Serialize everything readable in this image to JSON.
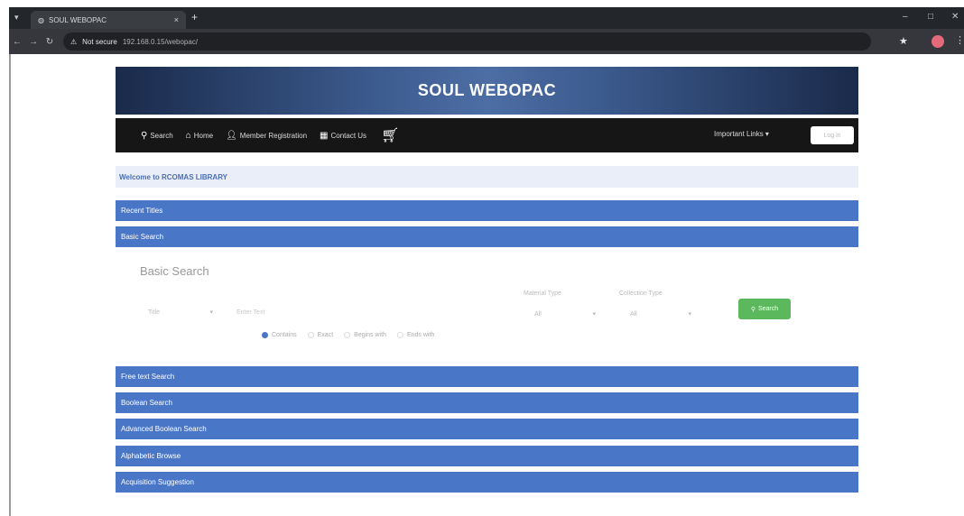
{
  "browser": {
    "tab_title": "SOUL WEBOPAC",
    "tab_close": "×",
    "new_tab": "+",
    "security_label": "Not secure",
    "url": "192.168.0.15/webopac/",
    "icons": [
      "back-icon",
      "forward-icon",
      "reload-icon",
      "warning-icon",
      "star-icon",
      "profile-icon",
      "menu-icon"
    ]
  },
  "banner": {
    "title": "SOUL WEBOPAC"
  },
  "navbar": {
    "items": [
      {
        "label": "Search",
        "icon": "search-icon"
      },
      {
        "label": "Home",
        "icon": "home-icon"
      },
      {
        "label": "Member Registration",
        "icon": "user-icon"
      },
      {
        "label": "Contact Us",
        "icon": "contact-icon"
      }
    ],
    "cart_icon": "cart-icon",
    "important_links": "Important Links ▾",
    "login": "Log in"
  },
  "welcome": "Welcome to RCOMAS LIBRARY",
  "panels_top": [
    "Recent Titles",
    "Basic Search"
  ],
  "basic_search": {
    "heading": "Basic Search",
    "field_select": "Title",
    "text_placeholder": "Enter Text",
    "material_type_label": "Material Type",
    "material_type_value": "All",
    "collection_type_label": "Collection Type",
    "collection_type_value": "All",
    "search_button": "Search",
    "match_options": [
      "Contains",
      "Exact",
      "Begins with",
      "Ends with"
    ],
    "selected_match": "Contains"
  },
  "panels_bottom": [
    "Free text Search",
    "Boolean Search",
    "Advanced Boolean Search",
    "Alphabetic Browse",
    "Acquisition Suggestion"
  ],
  "colors": {
    "panel_blue": "#4a76c8",
    "navbar": "#161616",
    "search_green": "#5cb85c"
  }
}
